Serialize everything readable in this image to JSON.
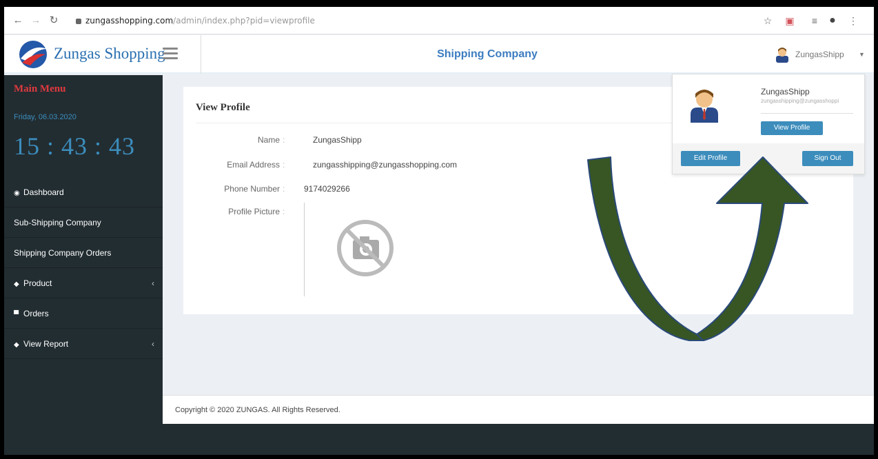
{
  "browser": {
    "url_host": "zungasshopping.com",
    "url_path": "/admin/index.php?pid=viewprofile"
  },
  "header": {
    "brand": "Zungas Shopping",
    "title": "Shipping Company",
    "user_name": "ZungasShipp"
  },
  "sidebar": {
    "title": "Main Menu",
    "date": "Friday, 06.03.2020",
    "clock": "15 : 43 : 43",
    "items": [
      {
        "label": "Dashboard",
        "icon": "dashboard-icon"
      },
      {
        "label": "Sub-Shipping Company"
      },
      {
        "label": "Shipping Company Orders"
      },
      {
        "label": "Product",
        "icon": "cube-icon",
        "expandable": true
      },
      {
        "label": "Orders",
        "icon": "cart-icon"
      },
      {
        "label": "View Report",
        "icon": "report-icon",
        "expandable": true
      }
    ]
  },
  "profile": {
    "heading": "View Profile",
    "fields": [
      {
        "label": "Name",
        "value": "ZungasShipp"
      },
      {
        "label": "Email Address",
        "value": "zungasshipping@zungasshopping.com"
      },
      {
        "label": "Phone Number",
        "value": "9174029266"
      },
      {
        "label": "Profile Picture",
        "value": ""
      }
    ]
  },
  "dropdown": {
    "name": "ZungasShipp",
    "email": "zungasshipping@zungasshoppi",
    "view_profile": "View Profile",
    "edit_profile": "Edit Profile",
    "sign_out": "Sign Out"
  },
  "footer": {
    "text": "Copyright © 2020 ZUNGAS. All Rights Reserved."
  },
  "colors": {
    "accent": "#3c8dbc",
    "sidebar_bg": "#222d32",
    "menu_title": "#e0393e",
    "arrow_fill": "#375623"
  }
}
